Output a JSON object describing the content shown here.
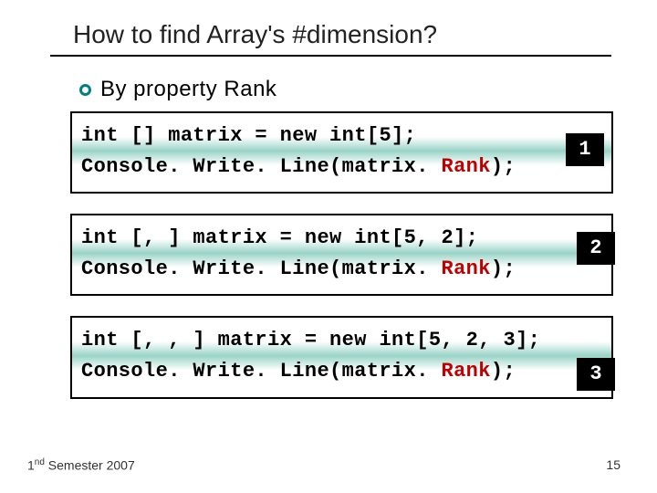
{
  "title": "How to find Array's #dimension?",
  "bullet": "By property Rank",
  "code1": {
    "line1a": "int [] matrix = new int[5];",
    "line2a": "Console. Write. Line(matrix. ",
    "line2b": "Rank",
    "line2c": ");",
    "badge": "1"
  },
  "code2": {
    "line1a": "int [, ] matrix = new int[5, 2];",
    "line2a": "Console. Write. Line(matrix. ",
    "line2b": "Rank",
    "line2c": ");",
    "badge": "2"
  },
  "code3": {
    "line1a": "int [, , ] matrix = new int[5, 2, 3];",
    "line2a": "Console. Write. Line(matrix. ",
    "line2b": "Rank",
    "line2c": ");",
    "badge": "3"
  },
  "footer": {
    "semester_prefix": "1",
    "semester_suffix": "nd",
    "semester_text": " Semester 2007",
    "page": "15"
  }
}
